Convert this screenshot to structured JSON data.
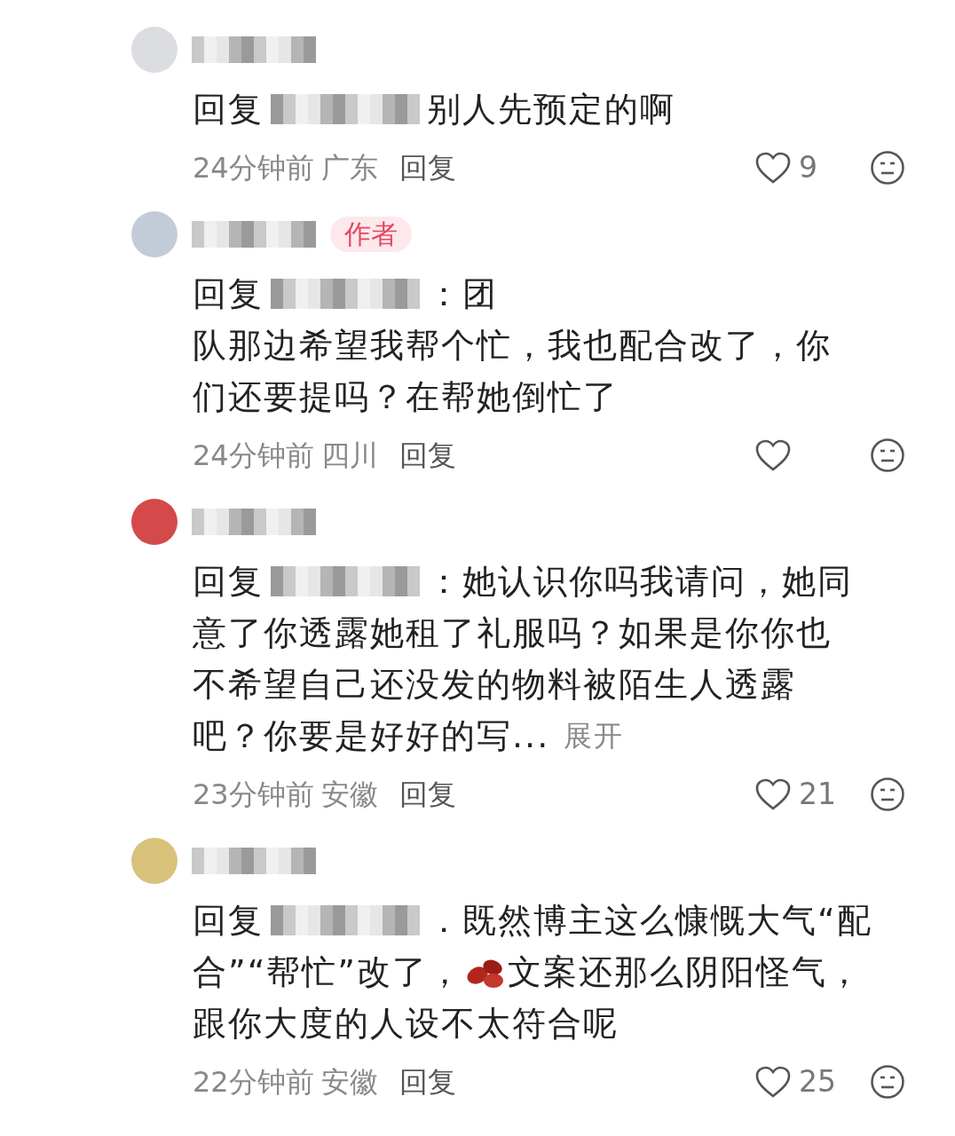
{
  "comments": [
    {
      "lines": [
        [
          {
            "kind": "reply",
            "text": "回复"
          },
          {
            "kind": "mosaic"
          },
          {
            "kind": "text",
            "text": "别人先预定的啊"
          }
        ]
      ],
      "time": "24分钟前",
      "location": "广东",
      "reply": "回复",
      "likes": "9"
    },
    {
      "badge": "作者",
      "lines": [
        [
          {
            "kind": "reply",
            "text": "回复"
          },
          {
            "kind": "mosaic"
          },
          {
            "kind": "text",
            "text": "：团"
          }
        ],
        [
          {
            "kind": "text",
            "text": "队那边希望我帮个忙，我也配合改了，你"
          }
        ],
        [
          {
            "kind": "text",
            "text": "们还要提吗？在帮她倒忙了"
          }
        ]
      ],
      "time": "24分钟前",
      "location": "四川",
      "reply": "回复"
    },
    {
      "lines": [
        [
          {
            "kind": "reply",
            "text": "回复"
          },
          {
            "kind": "mosaic"
          },
          {
            "kind": "text",
            "text": "：她认识你吗我请问，她同"
          }
        ],
        [
          {
            "kind": "text",
            "text": "意了你透露她租了礼服吗？如果是你你也"
          }
        ],
        [
          {
            "kind": "text",
            "text": "不希望自己还没发的物料被陌生人透露"
          }
        ],
        [
          {
            "kind": "text",
            "text": "吧？你要是好好的写..."
          },
          {
            "kind": "expand",
            "text": "展开"
          }
        ]
      ],
      "time": "23分钟前",
      "location": "安徽",
      "reply": "回复",
      "likes": "21"
    },
    {
      "lines": [
        [
          {
            "kind": "reply",
            "text": "回复"
          },
          {
            "kind": "mosaic"
          },
          {
            "kind": "text",
            "text": "．既然博主这么慷慨大气“配"
          }
        ],
        [
          {
            "kind": "text",
            "text": "合”“帮忙”改了，"
          },
          {
            "kind": "emoji"
          },
          {
            "kind": "text",
            "text": "文案还那么阴阳怪气，"
          }
        ],
        [
          {
            "kind": "text",
            "text": "跟你大度的人设不太符合呢"
          }
        ]
      ],
      "time": "22分钟前",
      "location": "安徽",
      "reply": "回复",
      "likes": "25"
    }
  ]
}
